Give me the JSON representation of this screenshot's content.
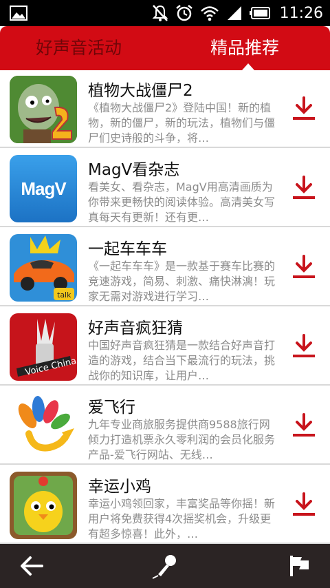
{
  "status_bar": {
    "time": "11:26",
    "icons": [
      "image-icon",
      "mute-icon",
      "alarm-icon",
      "wifi-icon",
      "signal-icon",
      "battery-icon"
    ]
  },
  "tabs": [
    {
      "label": "好声音活动",
      "active": false
    },
    {
      "label": "精品推荐",
      "active": true
    }
  ],
  "apps": [
    {
      "name": "植物大战僵尸2",
      "desc": "《植物大战僵尸2》登陆中国！新的植物，新的僵尸，新的玩法，植物们与僵尸们史诗般的斗争，将…",
      "icon": "zombie-game-icon"
    },
    {
      "name": "MagV看杂志",
      "desc": "看美女、看杂志，MagV用高清画质为你带来更畅快的阅读体验。高清美女写真每天有更新！还有更…",
      "icon": "magv-app-icon",
      "icon_text": "MagV"
    },
    {
      "name": "一起车车车",
      "desc": "《一起车车车》是一款基于赛车比赛的竞速游戏，简易、刺激、痛快淋漓！玩家无需对游戏进行学习…",
      "icon": "race-car-game-icon"
    },
    {
      "name": "好声音疯狂猜",
      "desc": "中国好声音疯狂猜是一款结合好声音打造的游戏，结合当下最流行的玩法，挑战你的知识库，让用户…",
      "icon": "voice-china-app-icon"
    },
    {
      "name": "爱飞行",
      "desc": "九年专业商旅服务提供商9588旅行网倾力打造机票永久零利润的会员化服务产品-爱飞行网站、无线…",
      "icon": "aifeixing-logo-icon"
    },
    {
      "name": "幸运小鸡",
      "desc": "幸运小鸡领回家，丰富奖品等你摇！新用户将免费获得4次摇奖机会，升级更有超多惊喜！此外，…",
      "icon": "lucky-chick-app-icon"
    }
  ],
  "colors": {
    "brand_red": "#d20b14",
    "inactive_tab": "#6f0608",
    "download_red": "#c8141c",
    "bottom_bar": "#2b2424"
  },
  "bottom_bar": {
    "icons": [
      "back-arrow-icon",
      "microphone-icon",
      "flag-icon"
    ]
  }
}
